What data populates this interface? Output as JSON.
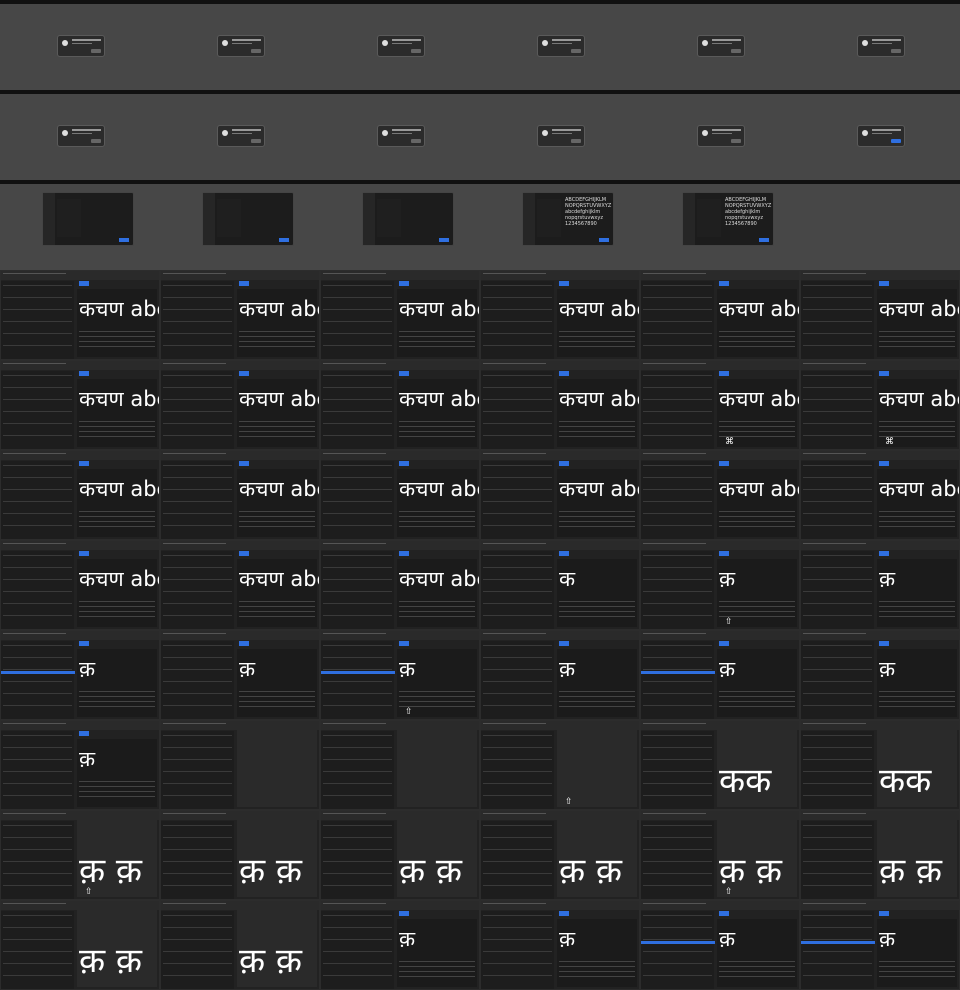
{
  "sample_text": "कचण abc",
  "glyph_single": "क",
  "glyph_nukta": "क़",
  "glyph_pair": "कक",
  "glyph_pair_nukta": "क़ क़",
  "font_preview": "ABCDEFGHIJKLM NOPQRSTUVWXYZ abcdefghijklm nopqrstuvwxyz 1234567890",
  "cmd_symbol": "⌘",
  "shift_symbol": "⇧",
  "colors": {
    "accent": "#2f6fe0",
    "background": "#222222",
    "desktop": "#474747"
  }
}
